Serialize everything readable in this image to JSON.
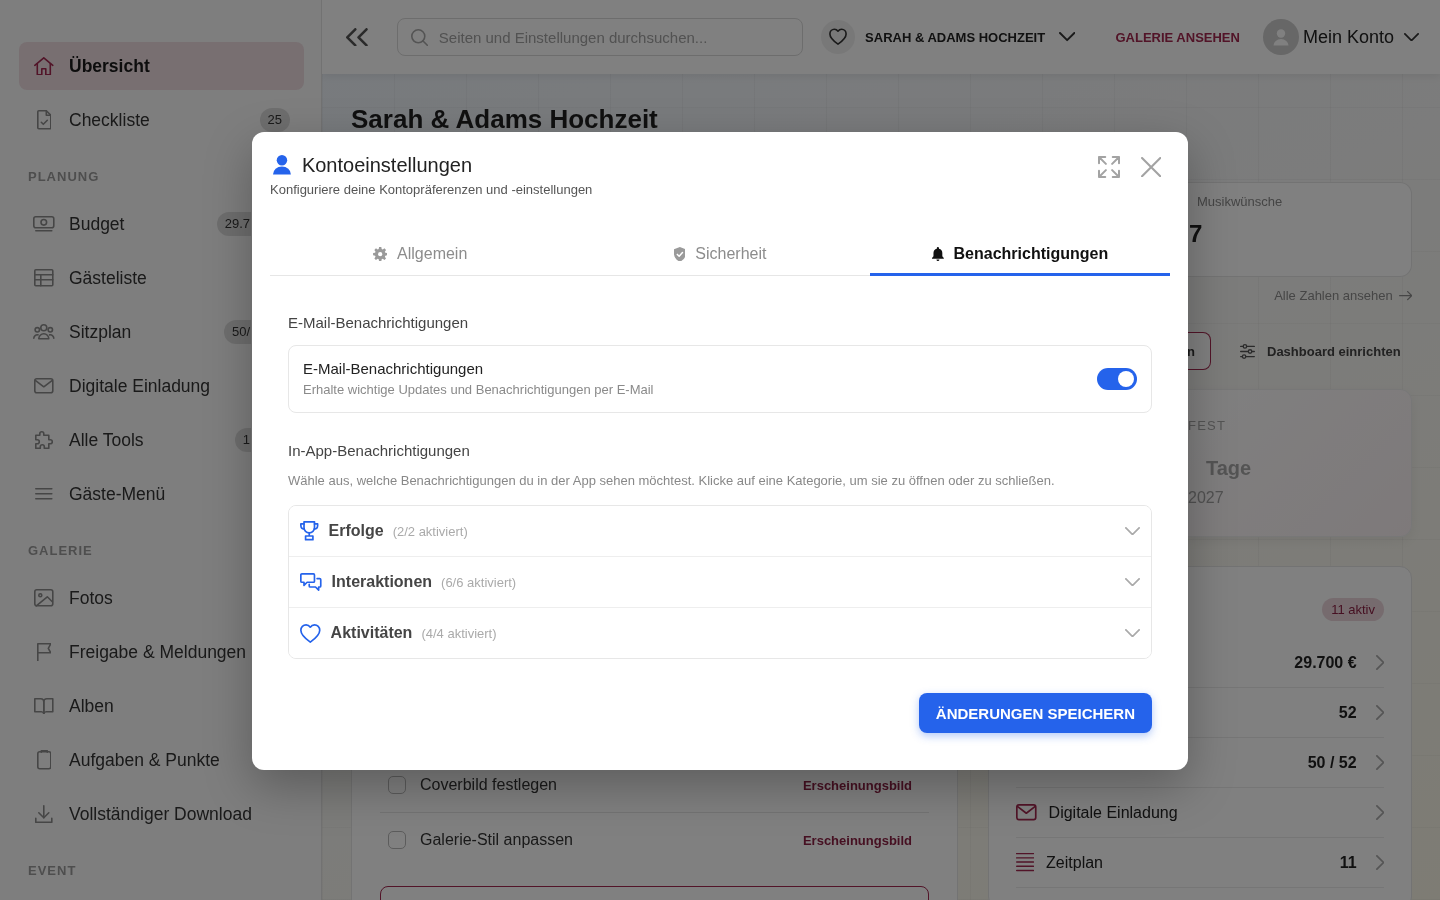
{
  "sidebar": {
    "groups": [
      {
        "items": [
          {
            "label": "Übersicht",
            "selected": true
          },
          {
            "label": "Checkliste",
            "badge": "25",
            "selected": false
          }
        ]
      },
      {
        "heading": "PLANUNG",
        "items": [
          {
            "label": "Budget",
            "badge": "29.7",
            "selected": false
          },
          {
            "label": "Gästeliste",
            "selected": false
          },
          {
            "label": "Sitzplan",
            "badge": "50/",
            "selected": false
          },
          {
            "label": "Digitale Einladung",
            "selected": false
          },
          {
            "label": "Alle Tools",
            "badge": "1",
            "selected": false
          },
          {
            "label": "Gäste-Menü",
            "selected": false
          }
        ]
      },
      {
        "heading": "GALERIE",
        "items": [
          {
            "label": "Fotos",
            "selected": false
          },
          {
            "label": "Freigabe & Meldungen",
            "selected": false
          },
          {
            "label": "Alben",
            "selected": false
          },
          {
            "label": "Aufgaben & Punkte",
            "selected": false
          },
          {
            "label": "Vollständiger Download",
            "selected": false
          }
        ]
      },
      {
        "heading": "EVENT"
      }
    ]
  },
  "topbar": {
    "search": {
      "placeholder": "Seiten und Einstellungen durchsuchen..."
    },
    "event": "SARAH & ADAMS HOCHZEIT",
    "gallery_link": "GALERIE ANSEHEN",
    "account": "Mein Konto"
  },
  "dashboard": {
    "title": "Sarah & Adams Hochzeit",
    "stat": {
      "label": "Musikwünsche",
      "value": "7"
    },
    "all_stats_link": "Alle Zahlen ansehen",
    "actions": [
      {
        "label": "n",
        "kind": "outline"
      },
      {
        "label": "Dashboard einrichten",
        "kind": "plain"
      }
    ],
    "countdown": {
      "label": "FEST",
      "unit": "Tage",
      "date": "2027"
    },
    "tools": {
      "badge": "11 aktiv",
      "rows": [
        {
          "value": "29.700 €"
        },
        {
          "value": "52"
        },
        {
          "value": "50 / 52"
        },
        {
          "label": "Digitale Einladung"
        },
        {
          "label": "Zeitplan",
          "value": "11"
        }
      ]
    },
    "checklist": {
      "items": [
        {
          "label": "Coverbild festlegen",
          "tag": "Erscheinungsbild",
          "checked": false
        },
        {
          "label": "Galerie-Stil anpassen",
          "tag": "Erscheinungsbild",
          "checked": false
        }
      ]
    }
  },
  "modal": {
    "title": "Kontoeinstellungen",
    "subtitle": "Konfiguriere deine Kontopräferenzen und -einstellungen",
    "tabs": [
      {
        "label": "Allgemein",
        "selected": false
      },
      {
        "label": "Sicherheit",
        "selected": false
      },
      {
        "label": "Benachrichtigungen",
        "selected": true
      }
    ],
    "email": {
      "heading": "E-Mail-Benachrichtigungen",
      "rows": [
        {
          "title": "E-Mail-Benachrichtigungen",
          "description": "Erhalte wichtige Updates und Benachrichtigungen per E-Mail",
          "on": true
        }
      ]
    },
    "in_app": {
      "heading": "In-App-Benachrichtigungen",
      "description": "Wähle aus, welche Benachrichtigungen du in der App sehen möchtest. Klicke auf eine Kategorie, um sie zu öffnen oder zu schließen.",
      "categories": [
        {
          "title": "Erfolge",
          "count": "(2/2 aktiviert)",
          "expanded": false
        },
        {
          "title": "Interaktionen",
          "count": "(6/6 aktiviert)",
          "expanded": false
        },
        {
          "title": "Aktivitäten",
          "count": "(4/4 aktiviert)",
          "expanded": false
        }
      ]
    },
    "save_button": "ÄNDERUNGEN SPEICHERN"
  }
}
